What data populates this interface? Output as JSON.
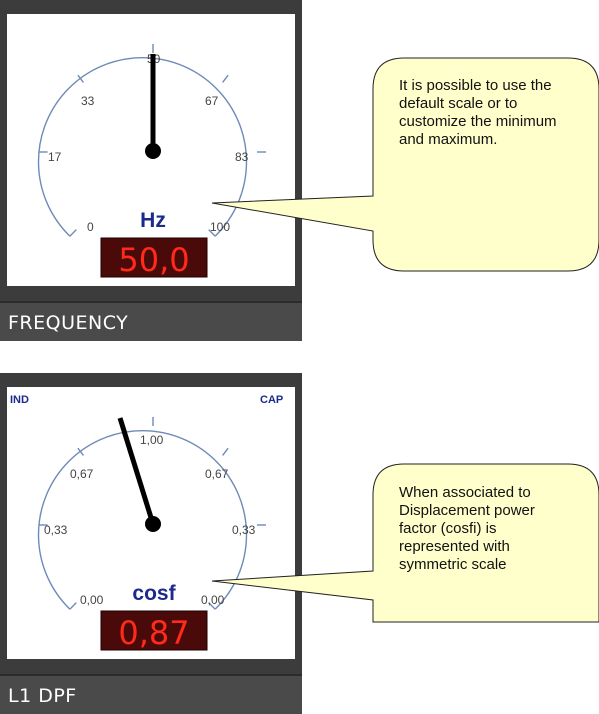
{
  "frequency_widget": {
    "scale_labels": [
      "0",
      "17",
      "33",
      "50",
      "67",
      "83",
      "100"
    ],
    "unit": "Hz",
    "reading": "50,0",
    "title": "FREQUENCY",
    "callout_text": "It is possible to use the default scale or to customize the minimum and maximum."
  },
  "dpf_widget": {
    "corner_left": "IND",
    "corner_right": "CAP",
    "scale_labels": [
      "0,00",
      "0,33",
      "0,67",
      "1,00",
      "0,67",
      "0,33",
      "0,00"
    ],
    "unit": "cosf",
    "reading": "0,87",
    "title": "L1 DPF",
    "callout_text": "When associated to Displacement power factor (cosfi) is represented with symmetric scale"
  },
  "colors": {
    "frame": "#3c3c3c",
    "scale": "#6e8ab8",
    "unit_text": "#1c2a8c",
    "readout_bg": "#4a0a0a",
    "readout_text": "#ff2a1a",
    "callout_fill": "#ffffcc"
  }
}
